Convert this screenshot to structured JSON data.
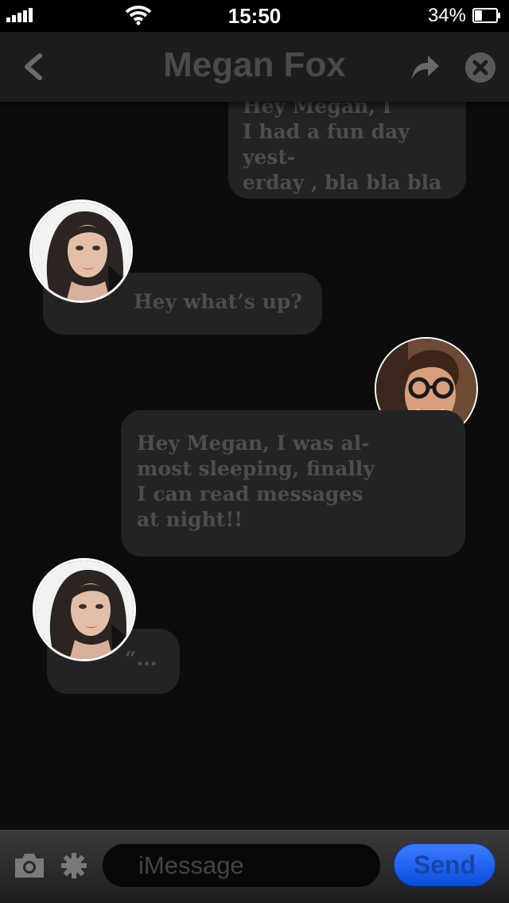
{
  "status_bar": {
    "time": "15:50",
    "battery_percent": "34%",
    "battery_level": 0.34
  },
  "nav": {
    "title": "Megan Fox"
  },
  "messages": [
    {
      "sender": "me",
      "text": "Hey Megan, I\nI had a fun day yest-\nerday , bla bla bla"
    },
    {
      "sender": "contact",
      "text": "Hey what’s up?"
    },
    {
      "sender": "me",
      "text": "Hey Megan, I was al-\nmost sleeping, finally\nI can read messages\n at night!!"
    },
    {
      "sender": "contact",
      "text": "“..."
    }
  ],
  "input_bar": {
    "placeholder": "iMessage",
    "send_label": "Send"
  },
  "icons": {
    "back": "chevron-left-icon",
    "share": "share-arrow-icon",
    "close": "close-icon",
    "camera": "camera-icon",
    "gear": "gear-icon"
  },
  "colors": {
    "background": "#0c0c0c",
    "bubble": "#232323",
    "bubble_text": "#4d4d4d",
    "title": "#4a4a4a",
    "send_button": "#1e63f0"
  }
}
